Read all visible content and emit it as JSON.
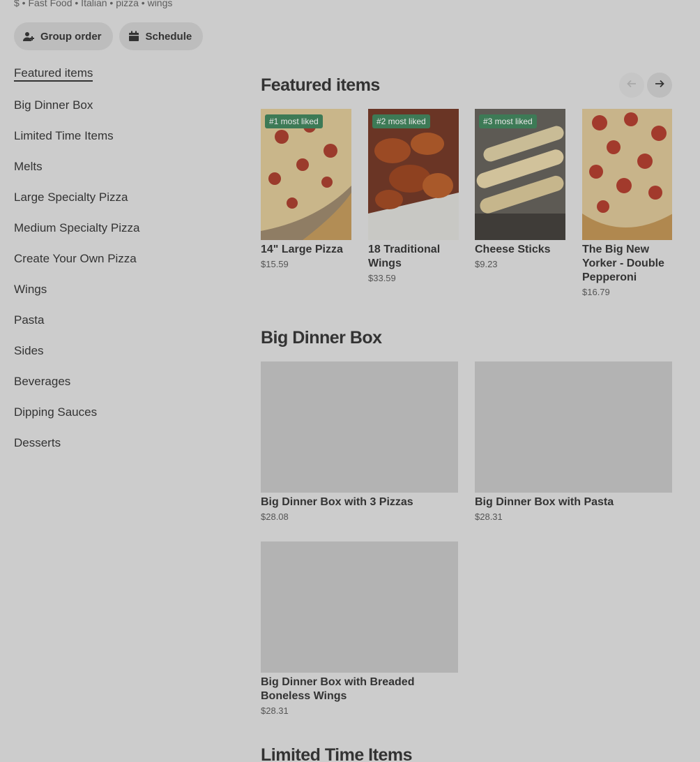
{
  "store": {
    "tags": "$ • Fast Food • Italian • pizza • wings"
  },
  "actions": {
    "group_order": "Group order",
    "schedule": "Schedule"
  },
  "sidebar": {
    "items": [
      {
        "label": "Featured items",
        "active": true
      },
      {
        "label": "Big Dinner Box"
      },
      {
        "label": "Limited Time Items"
      },
      {
        "label": "Melts"
      },
      {
        "label": "Large Specialty Pizza"
      },
      {
        "label": "Medium Specialty Pizza"
      },
      {
        "label": "Create Your Own Pizza"
      },
      {
        "label": "Wings"
      },
      {
        "label": "Pasta"
      },
      {
        "label": "Sides"
      },
      {
        "label": "Beverages"
      },
      {
        "label": "Dipping Sauces"
      },
      {
        "label": "Desserts"
      }
    ]
  },
  "featured": {
    "title": "Featured items",
    "items": [
      {
        "badge": "#1 most liked",
        "name": "14\" Large Pizza",
        "price": "$15.59",
        "image": "pepperoni-pizza"
      },
      {
        "badge": "#2 most liked",
        "name": "18 Traditional Wings",
        "price": "$33.59",
        "image": "wings"
      },
      {
        "badge": "#3 most liked",
        "name": "Cheese Sticks",
        "price": "$9.23",
        "image": "cheese-sticks"
      },
      {
        "badge": "",
        "name": "The Big New Yorker - Double Pepperoni",
        "price": "$16.79",
        "image": "pepperoni-pizza"
      }
    ]
  },
  "big_dinner_box": {
    "title": "Big Dinner Box",
    "items": [
      {
        "name": "Big Dinner Box with 3 Pizzas",
        "price": "$28.08"
      },
      {
        "name": "Big Dinner Box with Pasta",
        "price": "$28.31"
      },
      {
        "name": "Big Dinner Box with Breaded Boneless Wings",
        "price": "$28.31"
      }
    ]
  },
  "limited_time": {
    "title": "Limited Time Items"
  }
}
